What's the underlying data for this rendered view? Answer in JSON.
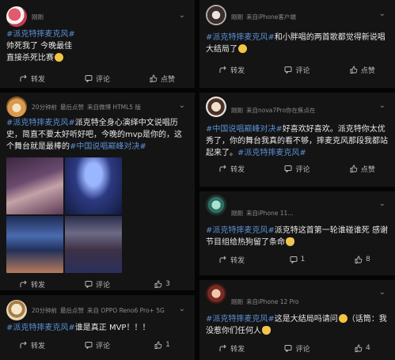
{
  "left": {
    "posts": [
      {
        "meta": [
          "刚刚"
        ],
        "text_plain": "帅死我了 今晚最佳 直接杀死比赛",
        "tag": "#派克特摔麦克风#",
        "line1": "帅死我了 今晚最佳",
        "line2": "直接杀死比赛",
        "actions": {
          "repost": "转发",
          "comment": "评论",
          "like": "点赞"
        }
      },
      {
        "meta": [
          "20分钟前",
          "最后点赞",
          "来自微博 HTML5 版"
        ],
        "tag": "#派克特摔麦克风#",
        "text": "派克特全身心演绎中文说唱历史，简直不要太好听好吧，今晚的mvp是你的，这个舞台就是最棒的",
        "tag2": "#中国说唱巅峰对决#",
        "actions": {
          "repost": "转发",
          "comment": "评论",
          "like": "3"
        }
      },
      {
        "meta": [
          "20分钟前",
          "最后点赞",
          "来自 OPPO Reno6 Pro+ 5G"
        ],
        "tag": "#派克特摔麦克风#",
        "text": "谁是真正 MVP！！！",
        "actions": {
          "repost": "转发",
          "comment": "评论",
          "like": "1"
        }
      }
    ]
  },
  "right": {
    "posts": [
      {
        "meta": [
          "刚刚",
          "来自iPhone客户端"
        ],
        "tag": "#派克特摔麦克风#",
        "text": "和小胖唱的两首歌都觉得新说唱大结局了",
        "actions": {
          "repost": "转发",
          "comment": "评论",
          "like": "点赞"
        }
      },
      {
        "meta": [
          "刚刚",
          "来自nova7Pro你在焦点在"
        ],
        "tag": "#中国说唱巅峰对决#",
        "text": "好喜欢好喜欢。派克特你太优秀了，你的舞台我真的看不够，摔麦克风那段我都站起来了。",
        "tag2": "#派克特摔麦克风#",
        "actions": {
          "repost": "转发",
          "comment": "评论",
          "like": "点赞"
        }
      },
      {
        "meta": [
          "刚刚",
          "来自iPhone 11..."
        ],
        "tag": "#派克特摔麦克风#",
        "text": "派克特这首第一轮谁碰谁死 感谢节目组给热狗留了条命",
        "actions": {
          "repost": "转发",
          "comment": "1",
          "like": "8"
        }
      },
      {
        "meta": [
          "刚刚",
          "来自iPhone 12 Pro"
        ],
        "tag": "#派克特摔麦克风#",
        "text": "这是大结局吗请问",
        "text2": "（话筒：我没惹你们任何人",
        "actions": {
          "repost": "转发",
          "comment": "评论",
          "like": "4"
        }
      }
    ]
  },
  "colors": {
    "background": "#141415",
    "hashtag": "#5a8fd0",
    "meta": "#8b8b8b",
    "text": "#e9e9e9"
  },
  "icons": [
    "repost-icon",
    "comment-icon",
    "like-icon",
    "chevron-down-icon"
  ]
}
